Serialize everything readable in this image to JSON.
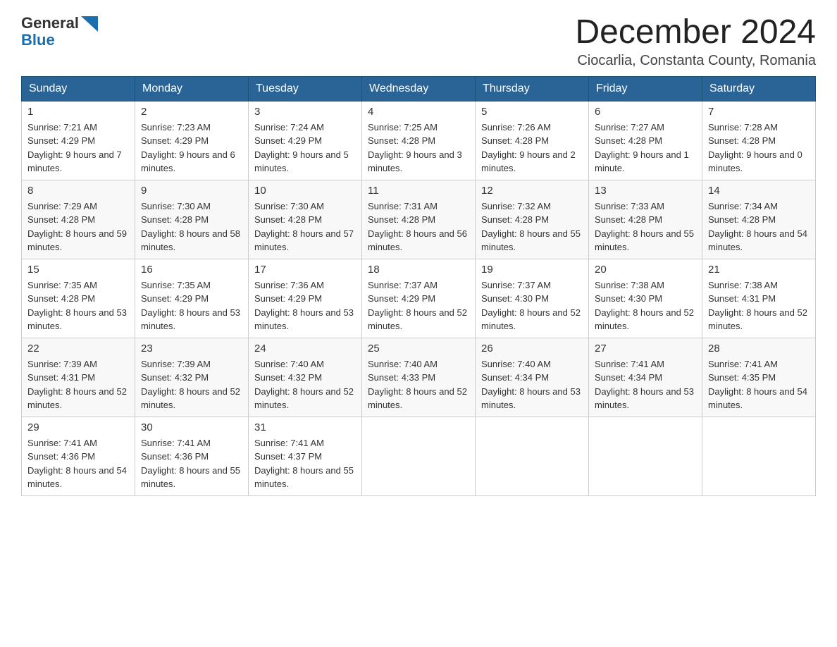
{
  "header": {
    "logo_general": "General",
    "logo_blue": "Blue",
    "month_year": "December 2024",
    "location": "Ciocarlia, Constanta County, Romania"
  },
  "days_of_week": [
    "Sunday",
    "Monday",
    "Tuesday",
    "Wednesday",
    "Thursday",
    "Friday",
    "Saturday"
  ],
  "weeks": [
    [
      {
        "day": "1",
        "sunrise": "7:21 AM",
        "sunset": "4:29 PM",
        "daylight": "9 hours and 7 minutes."
      },
      {
        "day": "2",
        "sunrise": "7:23 AM",
        "sunset": "4:29 PM",
        "daylight": "9 hours and 6 minutes."
      },
      {
        "day": "3",
        "sunrise": "7:24 AM",
        "sunset": "4:29 PM",
        "daylight": "9 hours and 5 minutes."
      },
      {
        "day": "4",
        "sunrise": "7:25 AM",
        "sunset": "4:28 PM",
        "daylight": "9 hours and 3 minutes."
      },
      {
        "day": "5",
        "sunrise": "7:26 AM",
        "sunset": "4:28 PM",
        "daylight": "9 hours and 2 minutes."
      },
      {
        "day": "6",
        "sunrise": "7:27 AM",
        "sunset": "4:28 PM",
        "daylight": "9 hours and 1 minute."
      },
      {
        "day": "7",
        "sunrise": "7:28 AM",
        "sunset": "4:28 PM",
        "daylight": "9 hours and 0 minutes."
      }
    ],
    [
      {
        "day": "8",
        "sunrise": "7:29 AM",
        "sunset": "4:28 PM",
        "daylight": "8 hours and 59 minutes."
      },
      {
        "day": "9",
        "sunrise": "7:30 AM",
        "sunset": "4:28 PM",
        "daylight": "8 hours and 58 minutes."
      },
      {
        "day": "10",
        "sunrise": "7:30 AM",
        "sunset": "4:28 PM",
        "daylight": "8 hours and 57 minutes."
      },
      {
        "day": "11",
        "sunrise": "7:31 AM",
        "sunset": "4:28 PM",
        "daylight": "8 hours and 56 minutes."
      },
      {
        "day": "12",
        "sunrise": "7:32 AM",
        "sunset": "4:28 PM",
        "daylight": "8 hours and 55 minutes."
      },
      {
        "day": "13",
        "sunrise": "7:33 AM",
        "sunset": "4:28 PM",
        "daylight": "8 hours and 55 minutes."
      },
      {
        "day": "14",
        "sunrise": "7:34 AM",
        "sunset": "4:28 PM",
        "daylight": "8 hours and 54 minutes."
      }
    ],
    [
      {
        "day": "15",
        "sunrise": "7:35 AM",
        "sunset": "4:28 PM",
        "daylight": "8 hours and 53 minutes."
      },
      {
        "day": "16",
        "sunrise": "7:35 AM",
        "sunset": "4:29 PM",
        "daylight": "8 hours and 53 minutes."
      },
      {
        "day": "17",
        "sunrise": "7:36 AM",
        "sunset": "4:29 PM",
        "daylight": "8 hours and 53 minutes."
      },
      {
        "day": "18",
        "sunrise": "7:37 AM",
        "sunset": "4:29 PM",
        "daylight": "8 hours and 52 minutes."
      },
      {
        "day": "19",
        "sunrise": "7:37 AM",
        "sunset": "4:30 PM",
        "daylight": "8 hours and 52 minutes."
      },
      {
        "day": "20",
        "sunrise": "7:38 AM",
        "sunset": "4:30 PM",
        "daylight": "8 hours and 52 minutes."
      },
      {
        "day": "21",
        "sunrise": "7:38 AM",
        "sunset": "4:31 PM",
        "daylight": "8 hours and 52 minutes."
      }
    ],
    [
      {
        "day": "22",
        "sunrise": "7:39 AM",
        "sunset": "4:31 PM",
        "daylight": "8 hours and 52 minutes."
      },
      {
        "day": "23",
        "sunrise": "7:39 AM",
        "sunset": "4:32 PM",
        "daylight": "8 hours and 52 minutes."
      },
      {
        "day": "24",
        "sunrise": "7:40 AM",
        "sunset": "4:32 PM",
        "daylight": "8 hours and 52 minutes."
      },
      {
        "day": "25",
        "sunrise": "7:40 AM",
        "sunset": "4:33 PM",
        "daylight": "8 hours and 52 minutes."
      },
      {
        "day": "26",
        "sunrise": "7:40 AM",
        "sunset": "4:34 PM",
        "daylight": "8 hours and 53 minutes."
      },
      {
        "day": "27",
        "sunrise": "7:41 AM",
        "sunset": "4:34 PM",
        "daylight": "8 hours and 53 minutes."
      },
      {
        "day": "28",
        "sunrise": "7:41 AM",
        "sunset": "4:35 PM",
        "daylight": "8 hours and 54 minutes."
      }
    ],
    [
      {
        "day": "29",
        "sunrise": "7:41 AM",
        "sunset": "4:36 PM",
        "daylight": "8 hours and 54 minutes."
      },
      {
        "day": "30",
        "sunrise": "7:41 AM",
        "sunset": "4:36 PM",
        "daylight": "8 hours and 55 minutes."
      },
      {
        "day": "31",
        "sunrise": "7:41 AM",
        "sunset": "4:37 PM",
        "daylight": "8 hours and 55 minutes."
      },
      null,
      null,
      null,
      null
    ]
  ],
  "labels": {
    "sunrise_prefix": "Sunrise: ",
    "sunset_prefix": "Sunset: ",
    "daylight_prefix": "Daylight: "
  }
}
